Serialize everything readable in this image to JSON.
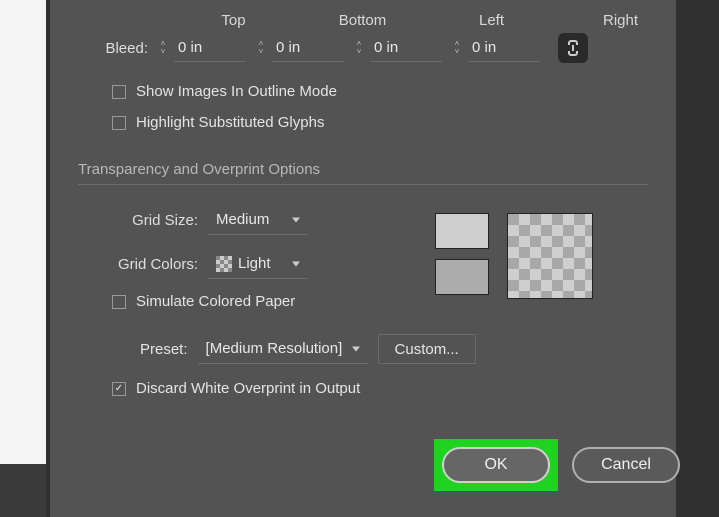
{
  "bleed": {
    "label": "Bleed:",
    "headers": {
      "top": "Top",
      "bottom": "Bottom",
      "left": "Left",
      "right": "Right"
    },
    "values": {
      "top": "0 in",
      "bottom": "0 in",
      "left": "0 in",
      "right": "0 in"
    }
  },
  "checks": {
    "show_images": "Show Images In Outline Mode",
    "highlight_glyphs": "Highlight Substituted Glyphs",
    "simulate_paper": "Simulate Colored Paper",
    "discard_white": "Discard White Overprint in Output"
  },
  "section": {
    "transparency": "Transparency and Overprint Options"
  },
  "grid": {
    "size_label": "Grid Size:",
    "size_value": "Medium",
    "colors_label": "Grid Colors:",
    "colors_value": "Light"
  },
  "preset": {
    "label": "Preset:",
    "value": "[Medium Resolution]",
    "custom": "Custom..."
  },
  "buttons": {
    "ok": "OK",
    "cancel": "Cancel"
  }
}
